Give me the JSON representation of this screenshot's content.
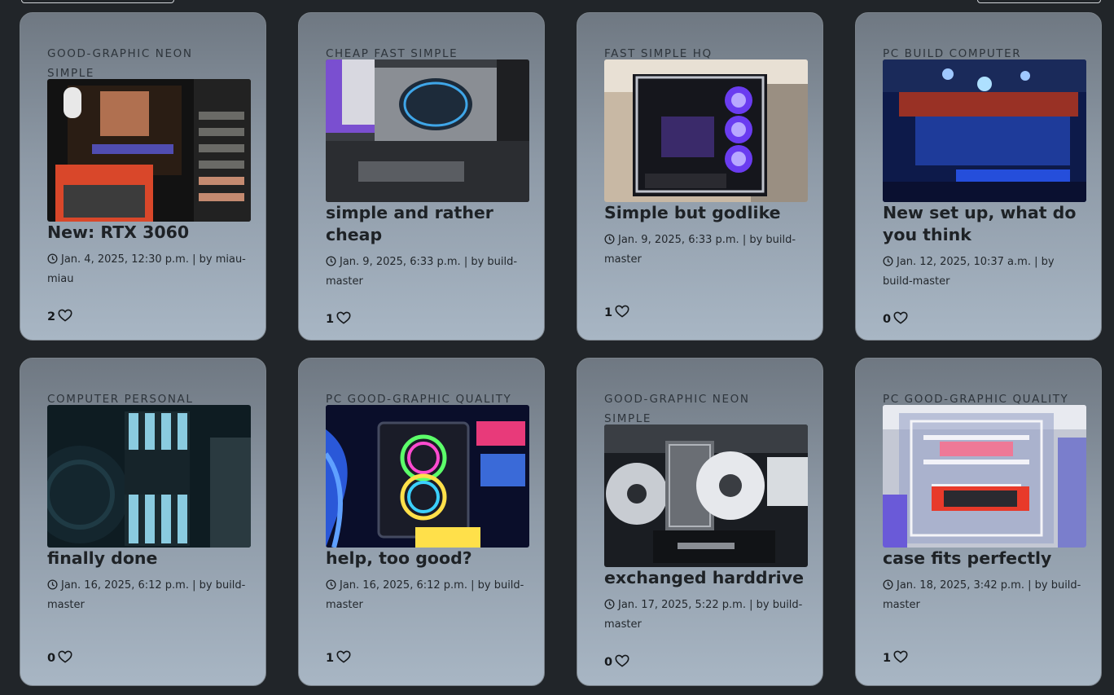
{
  "posts": [
    {
      "tags": "GOOD-GRAPHIC NEON SIMPLE",
      "title": "New: RTX 3060",
      "date": "Jan. 4, 2025, 12:30 p.m.",
      "byline": "| by miau-miau",
      "likes": "2",
      "image": "pc-interior-red-psu"
    },
    {
      "tags": "CHEAP FAST SIMPLE",
      "title": "simple and rather cheap",
      "date": "Jan. 9, 2025, 6:33 p.m.",
      "byline": "| by build-master",
      "likes": "1",
      "image": "geforce-rtx-fan"
    },
    {
      "tags": "FAST SIMPLE HQ",
      "title": "Simple but godlike",
      "date": "Jan. 9, 2025, 6:33 p.m.",
      "byline": "| by build-master",
      "likes": "1",
      "image": "glass-case-purple-fans"
    },
    {
      "tags": "PC BUILD COMPUTER",
      "title": "New set up, what do you think",
      "date": "Jan. 12, 2025, 10:37 a.m.",
      "byline": "| by build-master",
      "likes": "0",
      "image": "predator-geforce-blue"
    },
    {
      "tags": "COMPUTER PERSONAL",
      "title": "finally done",
      "date": "Jan. 16, 2025, 6:12 p.m.",
      "byline": "| by build-master",
      "likes": "0",
      "image": "dominator-ram-teal"
    },
    {
      "tags": "PC GOOD-GRAPHIC QUALITY",
      "title": "help, too good?",
      "date": "Jan. 16, 2025, 6:12 p.m.",
      "byline": "| by build-master",
      "likes": "1",
      "image": "rgb-fans-neon"
    },
    {
      "tags": "GOOD-GRAPHIC NEON SIMPLE",
      "title": "exchanged harddrive",
      "date": "Jan. 17, 2025, 5:22 p.m.",
      "byline": "| by build-master",
      "likes": "0",
      "image": "white-fan-cooler-evga"
    },
    {
      "tags": "PC GOOD-GRAPHIC QUALITY",
      "title": "case fits perfectly",
      "date": "Jan. 18, 2025, 3:42 p.m.",
      "byline": "| by build-master",
      "likes": "1",
      "image": "watercooled-pink-build"
    }
  ],
  "icons": {
    "date": "clock-icon",
    "like": "heart-outline-icon"
  }
}
